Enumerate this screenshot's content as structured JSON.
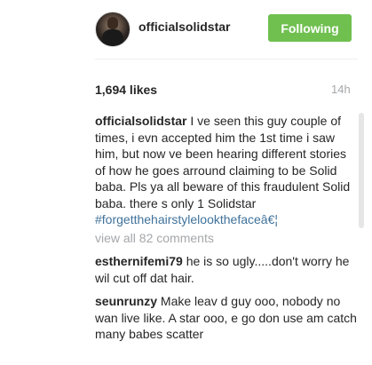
{
  "header": {
    "username": "officialsolidstar",
    "follow_label": "Following"
  },
  "post": {
    "likes": "1,694 likes",
    "time": "14h"
  },
  "caption": {
    "username": "officialsolidstar",
    "text": "I ve seen this guy couple of times, i evn accepted him the 1st time i saw him, but now ve been hearing different stories of how he goes arround claiming to be Solid baba. Pls ya all beware of this fraudulent Solid baba. there s only 1 Solidstar",
    "hashtag": "#forgetthehairstylelookthefaceâ€¦"
  },
  "view_all": "view all 82 comments",
  "comments": [
    {
      "username": "esthernifemi79",
      "text": "he is so ugly.....don't worry he wil cut off dat hair."
    },
    {
      "username": "seunrunzy",
      "text": "Make leav d guy ooo, nobody no wan live like. A star ooo, e go don use am catch many babes scatter"
    }
  ],
  "colors": {
    "follow_button": "#70c050",
    "hashtag": "#3f729b",
    "muted": "#a5a7aa"
  }
}
